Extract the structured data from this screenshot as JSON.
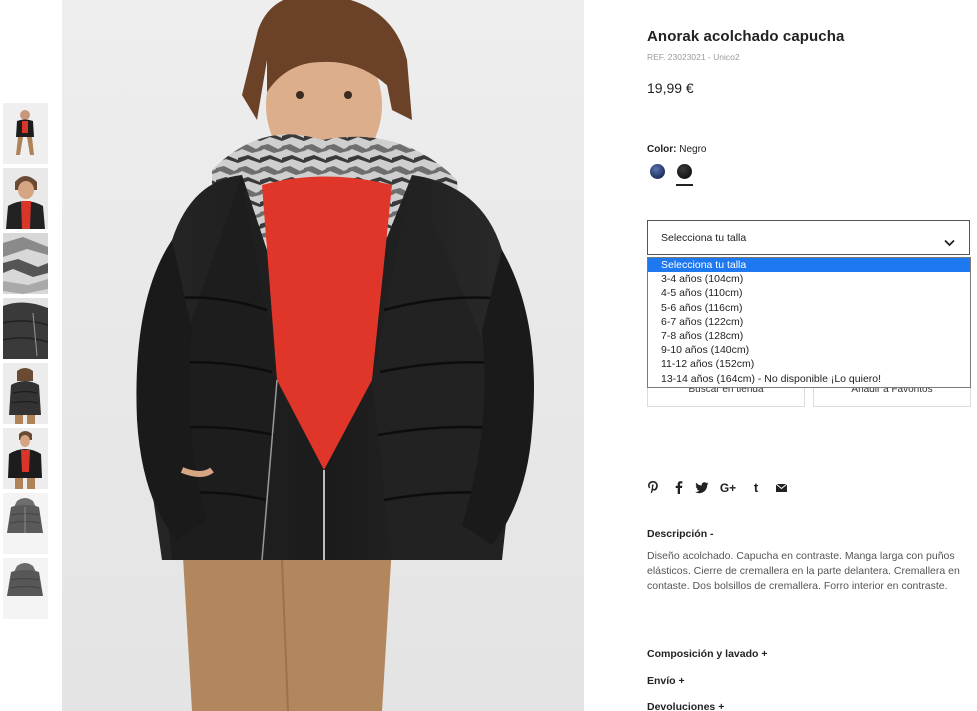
{
  "product": {
    "title": "Anorak acolchado capucha",
    "ref": "REF. 23023021 - Unico2",
    "price": "19,99 €"
  },
  "color": {
    "label": "Color:",
    "value": "Negro",
    "swatches": [
      {
        "name": "navy",
        "hex": "#22335f"
      },
      {
        "name": "black",
        "hex": "#1a1a1a",
        "selected": true
      }
    ]
  },
  "size": {
    "placeholder": "Selecciona tu talla",
    "options": [
      "Selecciona tu talla",
      "3-4 años (104cm)",
      "4-5 años (110cm)",
      "5-6 años (116cm)",
      "6-7 años (122cm)",
      "7-8 años (128cm)",
      "9-10 años (140cm)",
      "11-12 años (152cm)",
      "13-14 años (164cm) - No disponible ¡Lo quiero!"
    ],
    "highlight_color": "#1e78f0"
  },
  "buttons": {
    "store": "Buscar en tienda",
    "favorites": "Añadir a Favoritos"
  },
  "social": [
    {
      "name": "pinterest-icon",
      "glyph": "℘"
    },
    {
      "name": "facebook-icon",
      "glyph": "f"
    },
    {
      "name": "twitter-icon",
      "glyph": "🐦"
    },
    {
      "name": "google-plus-icon",
      "glyph": "G+"
    },
    {
      "name": "tumblr-icon",
      "glyph": "t"
    },
    {
      "name": "email-icon",
      "glyph": "✉"
    }
  ],
  "sections": {
    "description_title": "Descripción  -",
    "description_text": "Diseño acolchado. Capucha en contraste. Manga larga con puños elásticos. Cierre de cremallera en la parte delantera. Cremallera en contaste. Dos bolsillos de cremallera. Forro interior en contraste.",
    "composition_title": "Composición y lavado  +",
    "shipping_title": "Envío  +",
    "returns_title": "Devoluciones  +"
  },
  "images": {
    "main": "boy-wearing-black-padded-anorak",
    "thumbnails": [
      "thumb-full-body",
      "thumb-face",
      "thumb-lining-camo",
      "thumb-detail-grey",
      "thumb-back",
      "thumb-front-red",
      "thumb-product-front",
      "thumb-product-back"
    ]
  }
}
